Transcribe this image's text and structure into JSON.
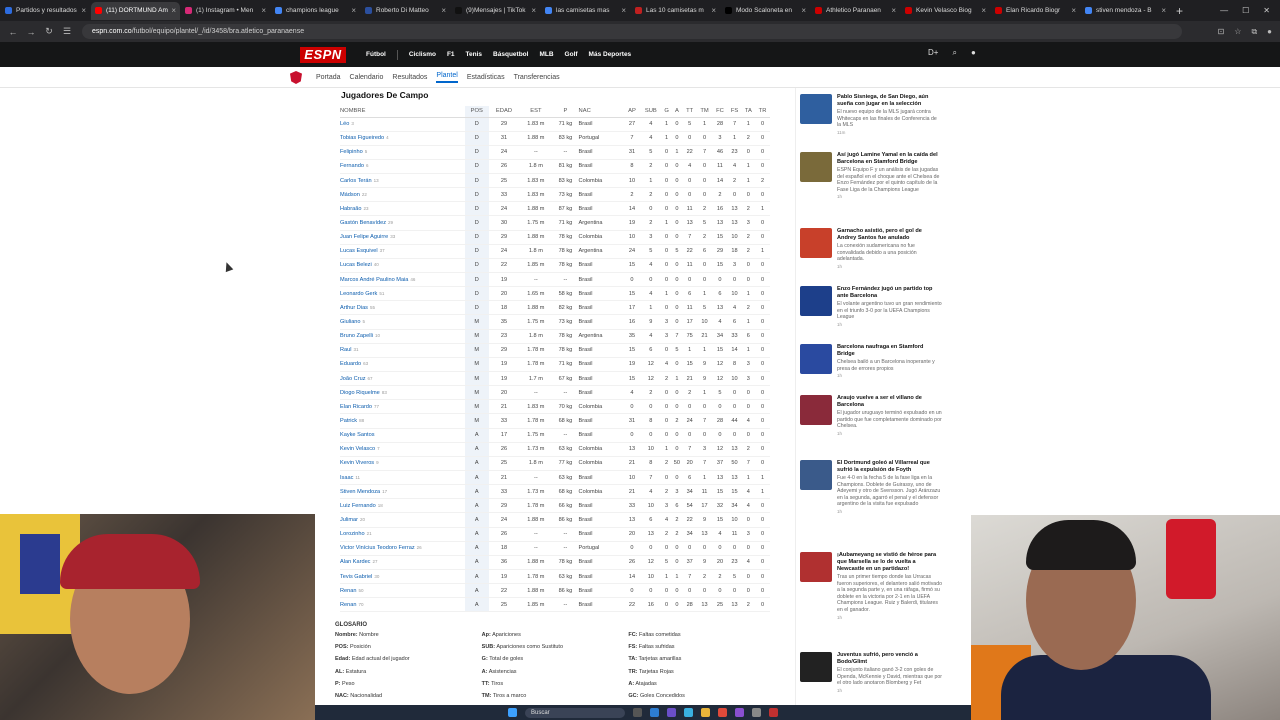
{
  "browser": {
    "tabs": [
      {
        "label": "Partidos y resultados",
        "color": "#2d6cdf"
      },
      {
        "label": "(11) DORTMUND Am",
        "color": "#ff0000",
        "active": true
      },
      {
        "label": "(1) Instagram • Men",
        "color": "#d62976"
      },
      {
        "label": "champions league",
        "color": "#4285f4"
      },
      {
        "label": "Roberto Di Matteo",
        "color": "#2b4f9e"
      },
      {
        "label": "(9)Mensajes | TikTok",
        "color": "#111111"
      },
      {
        "label": "las camisetas mas",
        "color": "#4285f4"
      },
      {
        "label": "Las 10 camisetas m",
        "color": "#c02020"
      },
      {
        "label": "Modo Scaloneta en",
        "color": "#000000"
      },
      {
        "label": "Athletico Paranaen",
        "color": "#cc0000"
      },
      {
        "label": "Kevin Velasco Biog",
        "color": "#cc0000"
      },
      {
        "label": "Elan Ricardo Biogr",
        "color": "#cc0000"
      },
      {
        "label": "stiven mendoza - B",
        "color": "#4285f4"
      }
    ],
    "url_host": "espn.com.co",
    "url_path": "/futbol/equipo/plantel/_/id/3458/bra.atletico_paranaense"
  },
  "espn": {
    "logo": "ESPN",
    "nav": [
      "Fútbol",
      "Ciclismo",
      "F1",
      "Tenis",
      "Básquetbol",
      "MLB",
      "Golf",
      "Más Deportes"
    ]
  },
  "subnav": [
    "Portada",
    "Calendario",
    "Resultados",
    "Plantel",
    "Estadísticas",
    "Transferencias"
  ],
  "section_title": "Jugadores De Campo",
  "columns": [
    "NOMBRE",
    "POS",
    "EDAD",
    "EST",
    "P",
    "NAC",
    "AP",
    "SUB",
    "G",
    "A",
    "TT",
    "TM",
    "FC",
    "FS",
    "TA",
    "TR"
  ],
  "players": [
    [
      "Léo",
      "3",
      "D",
      "29",
      "1.83 m",
      "71 kg",
      "Brasil",
      "27",
      "4",
      "1",
      "0",
      "5",
      "1",
      "28",
      "7",
      "1",
      "0"
    ],
    [
      "Tobias Figueiredo",
      "4",
      "D",
      "31",
      "1.88 m",
      "83 kg",
      "Portugal",
      "7",
      "4",
      "1",
      "0",
      "0",
      "0",
      "3",
      "1",
      "2",
      "0"
    ],
    [
      "Felipinho",
      "5",
      "D",
      "24",
      "--",
      "--",
      "Brasil",
      "31",
      "5",
      "0",
      "1",
      "22",
      "7",
      "46",
      "23",
      "0",
      "0"
    ],
    [
      "Fernando",
      "6",
      "D",
      "26",
      "1.8 m",
      "81 kg",
      "Brasil",
      "8",
      "2",
      "0",
      "0",
      "4",
      "0",
      "11",
      "4",
      "1",
      "0"
    ],
    [
      "Carlos Terán",
      "13",
      "D",
      "25",
      "1.83 m",
      "83 kg",
      "Colombia",
      "10",
      "1",
      "0",
      "0",
      "0",
      "0",
      "14",
      "2",
      "1",
      "2"
    ],
    [
      "Mádson",
      "22",
      "D",
      "33",
      "1.83 m",
      "73 kg",
      "Brasil",
      "2",
      "2",
      "0",
      "0",
      "0",
      "0",
      "2",
      "0",
      "0",
      "0"
    ],
    [
      "Habraão",
      "23",
      "D",
      "24",
      "1.88 m",
      "87 kg",
      "Brasil",
      "14",
      "0",
      "0",
      "0",
      "11",
      "2",
      "16",
      "13",
      "2",
      "1"
    ],
    [
      "Gastón Benavídez",
      "29",
      "D",
      "30",
      "1.75 m",
      "71 kg",
      "Argentina",
      "19",
      "2",
      "1",
      "0",
      "13",
      "5",
      "13",
      "13",
      "3",
      "0"
    ],
    [
      "Juan Felipe Aguirre",
      "33",
      "D",
      "29",
      "1.88 m",
      "78 kg",
      "Colombia",
      "10",
      "3",
      "0",
      "0",
      "7",
      "2",
      "15",
      "10",
      "2",
      "0"
    ],
    [
      "Lucas Esquivel",
      "37",
      "D",
      "24",
      "1.8 m",
      "78 kg",
      "Argentina",
      "24",
      "5",
      "0",
      "5",
      "22",
      "6",
      "29",
      "18",
      "2",
      "1"
    ],
    [
      "Lucas Belezi",
      "40",
      "D",
      "22",
      "1.85 m",
      "78 kg",
      "Brasil",
      "15",
      "4",
      "0",
      "0",
      "11",
      "0",
      "15",
      "3",
      "0",
      "0"
    ],
    [
      "Marcos André Paulino Maia",
      "46",
      "D",
      "19",
      "--",
      "--",
      "Brasil",
      "0",
      "0",
      "0",
      "0",
      "0",
      "0",
      "0",
      "0",
      "0",
      "0"
    ],
    [
      "Leonardo Gerk",
      "51",
      "D",
      "20",
      "1.65 m",
      "58 kg",
      "Brasil",
      "15",
      "4",
      "1",
      "0",
      "6",
      "1",
      "6",
      "10",
      "1",
      "0"
    ],
    [
      "Arthur Dias",
      "55",
      "D",
      "18",
      "1.88 m",
      "82 kg",
      "Brasil",
      "17",
      "1",
      "0",
      "0",
      "11",
      "5",
      "13",
      "4",
      "2",
      "0"
    ],
    [
      "Giuliano",
      "5",
      "M",
      "35",
      "1.75 m",
      "73 kg",
      "Brasil",
      "16",
      "9",
      "3",
      "0",
      "17",
      "10",
      "4",
      "6",
      "1",
      "0"
    ],
    [
      "Bruno Zapelli",
      "10",
      "M",
      "23",
      "1.8 m",
      "78 kg",
      "Argentina",
      "35",
      "4",
      "3",
      "7",
      "75",
      "21",
      "34",
      "33",
      "6",
      "0"
    ],
    [
      "Raul",
      "31",
      "M",
      "29",
      "1.78 m",
      "78 kg",
      "Brasil",
      "15",
      "6",
      "0",
      "5",
      "1",
      "1",
      "15",
      "14",
      "1",
      "0"
    ],
    [
      "Eduardo",
      "63",
      "M",
      "19",
      "1.78 m",
      "71 kg",
      "Brasil",
      "19",
      "12",
      "4",
      "0",
      "15",
      "9",
      "12",
      "8",
      "3",
      "0"
    ],
    [
      "João Cruz",
      "67",
      "M",
      "19",
      "1.7 m",
      "67 kg",
      "Brasil",
      "15",
      "12",
      "2",
      "1",
      "21",
      "9",
      "12",
      "10",
      "3",
      "0"
    ],
    [
      "Diogo Riquelme",
      "83",
      "M",
      "20",
      "--",
      "--",
      "Brasil",
      "4",
      "2",
      "0",
      "0",
      "2",
      "1",
      "5",
      "0",
      "0",
      "0"
    ],
    [
      "Elan Ricardo",
      "77",
      "M",
      "21",
      "1.83 m",
      "70 kg",
      "Colombia",
      "0",
      "0",
      "0",
      "0",
      "0",
      "0",
      "0",
      "0",
      "0",
      "0"
    ],
    [
      "Patrick",
      "88",
      "M",
      "33",
      "1.78 m",
      "68 kg",
      "Brasil",
      "31",
      "8",
      "0",
      "2",
      "24",
      "7",
      "28",
      "44",
      "4",
      "0"
    ],
    [
      "Kayke Santos",
      "",
      "A",
      "17",
      "1.75 m",
      "--",
      "Brasil",
      "0",
      "0",
      "0",
      "0",
      "0",
      "0",
      "0",
      "0",
      "0",
      "0"
    ],
    [
      "Kevin Velasco",
      "7",
      "A",
      "26",
      "1.73 m",
      "63 kg",
      "Colombia",
      "13",
      "10",
      "1",
      "0",
      "7",
      "3",
      "12",
      "13",
      "2",
      "0"
    ],
    [
      "Kevin Viveros",
      "9",
      "A",
      "25",
      "1.8 m",
      "77 kg",
      "Colombia",
      "21",
      "8",
      "2",
      "50",
      "20",
      "7",
      "37",
      "50",
      "7",
      "0"
    ],
    [
      "Isaac",
      "11",
      "A",
      "21",
      "--",
      "63 kg",
      "Brasil",
      "10",
      "7",
      "0",
      "0",
      "6",
      "1",
      "13",
      "13",
      "1",
      "1"
    ],
    [
      "Stiven Mendoza",
      "17",
      "A",
      "33",
      "1.73 m",
      "68 kg",
      "Colombia",
      "21",
      "4",
      "2",
      "3",
      "34",
      "11",
      "15",
      "15",
      "4",
      "1"
    ],
    [
      "Luiz Fernando",
      "18",
      "A",
      "29",
      "1.78 m",
      "66 kg",
      "Brasil",
      "33",
      "10",
      "3",
      "6",
      "54",
      "17",
      "32",
      "34",
      "4",
      "0"
    ],
    [
      "Julimar",
      "20",
      "A",
      "24",
      "1.88 m",
      "86 kg",
      "Brasil",
      "13",
      "6",
      "4",
      "2",
      "22",
      "9",
      "15",
      "10",
      "0",
      "0"
    ],
    [
      "Lorozinho",
      "21",
      "A",
      "26",
      "--",
      "--",
      "Brasil",
      "20",
      "13",
      "2",
      "2",
      "34",
      "13",
      "4",
      "11",
      "3",
      "0"
    ],
    [
      "Victor Vinícius Teodoro Ferraz",
      "26",
      "A",
      "18",
      "--",
      "--",
      "Portugal",
      "0",
      "0",
      "0",
      "0",
      "0",
      "0",
      "0",
      "0",
      "0",
      "0"
    ],
    [
      "Alan Kardec",
      "27",
      "A",
      "36",
      "1.88 m",
      "78 kg",
      "Brasil",
      "26",
      "12",
      "5",
      "0",
      "37",
      "9",
      "20",
      "23",
      "4",
      "0"
    ],
    [
      "Tevis Gabriel",
      "30",
      "A",
      "19",
      "1.78 m",
      "63 kg",
      "Brasil",
      "14",
      "10",
      "1",
      "1",
      "7",
      "2",
      "2",
      "5",
      "0",
      "0"
    ],
    [
      "Renan",
      "50",
      "A",
      "22",
      "1.88 m",
      "86 kg",
      "Brasil",
      "0",
      "0",
      "0",
      "0",
      "0",
      "0",
      "0",
      "0",
      "0",
      "0"
    ],
    [
      "Renan",
      "70",
      "A",
      "25",
      "1.85 m",
      "--",
      "Brasil",
      "22",
      "16",
      "0",
      "0",
      "28",
      "13",
      "25",
      "13",
      "2",
      "0"
    ]
  ],
  "glossary": {
    "title": "GLOSARIO",
    "col1": [
      [
        "Nombre:",
        "Nombre"
      ],
      [
        "POS:",
        "Posición"
      ],
      [
        "Edad:",
        "Edad actual del jugador"
      ],
      [
        "AL:",
        "Estatura"
      ],
      [
        "P:",
        "Peso"
      ],
      [
        "NAC:",
        "Nacionalidad"
      ]
    ],
    "col2": [
      [
        "Ap:",
        "Apariciones"
      ],
      [
        "SUB:",
        "Apariciones como Sustituto"
      ],
      [
        "G:",
        "Total de goles"
      ],
      [
        "A:",
        "Asistencias"
      ],
      [
        "TT:",
        "Tiros"
      ],
      [
        "TM:",
        "Tiros a marco"
      ]
    ],
    "col3": [
      [
        "FC:",
        "Faltas cometidas"
      ],
      [
        "FS:",
        "Faltas sufridas"
      ],
      [
        "TA:",
        "Tarjetas amarillas"
      ],
      [
        "TR:",
        "Tarjetas Rojas"
      ],
      [
        "A:",
        "Atajadas"
      ],
      [
        "GC:",
        "Goles Concedidos"
      ]
    ]
  },
  "news": [
    {
      "title": "Pablo Sisniega, de San Diego, aún sueña con jugar en la selección",
      "body": "El nuevo equipo de la MLS jugará contra Whitecaps en las finales de Conferencia de la MLS",
      "time": "11m",
      "color": "#2f5f9f"
    },
    {
      "title": "Así jugó Lamine Yamal en la caída del Barcelona en Stamford Bridge",
      "body": "ESPN Equipo F y un análisis de las jugadas del español en el choque ante el Chelsea de Enzo Fernández por el quinto capítulo de la Fase Liga de la Champions League",
      "time": "1h",
      "color": "#7a6a3a"
    },
    {
      "title": "Garnacho asistió, pero el gol de Andrey Santos fue anulado",
      "body": "La conexión sudamericana no fue convalidada debido a una posición adelantada.",
      "time": "1h",
      "color": "#c8402a"
    },
    {
      "title": "Enzo Fernández jugó un partido top ante Barcelona",
      "body": "El volante argentino tuvo un gran rendimiento en el triunfo 3-0 por la UEFA Champions League",
      "time": "1h",
      "color": "#1d3f8a"
    },
    {
      "title": "Barcelona naufraga en Stamford Bridge",
      "body": "Chelsea bailó a un Barcelona inoperante y presa de errores propios",
      "time": "1h",
      "color": "#2a4aa0"
    },
    {
      "title": "Araujo vuelve a ser el villano de Barcelona",
      "body": "El jugador uruguayo terminó expulsado en un partido que fue completamente dominado por Chelsea.",
      "time": "1h",
      "color": "#8a2a3a"
    },
    {
      "title": "El Dortmund goleó al Villarreal que sufrió la expulsión de Foyth",
      "body": "Fue 4-0 en la fecha 5 de la fase liga en la Champions. Doblete de Guirassy, uno de Adeyemi y otro de Svensson. Jugó Aránzazu en la segunda, agarró el penal y el defensor argentino de la visita fue expulsado",
      "time": "1h",
      "color": "#3a5a8a"
    },
    {
      "title": "¡Aubameyang se vistió de héroe para que Marsella se lo de vuelta a Newcastle en un partidazo!",
      "body": "Tras un primer tiempo donde las Urracas fueron superiores, el delantero salió motivado a la segunda parte y, en una ráfaga, firmó su doblete en la victoria por 2-1 en la UEFA Champions League. Ruiz y Balerdi, titulares en el ganador.",
      "time": "1h",
      "color": "#b03030"
    },
    {
      "title": "Juventus sufrió, pero venció a Bodo/Glimt",
      "body": "El conjunto italiano ganó 3-2 con goles de Openda, McKennie y David, mientras que por el otro lado anotaron Blomberg y Fet",
      "time": "1h",
      "color": "#222222"
    }
  ],
  "taskbar": {
    "search": "Buscar"
  }
}
